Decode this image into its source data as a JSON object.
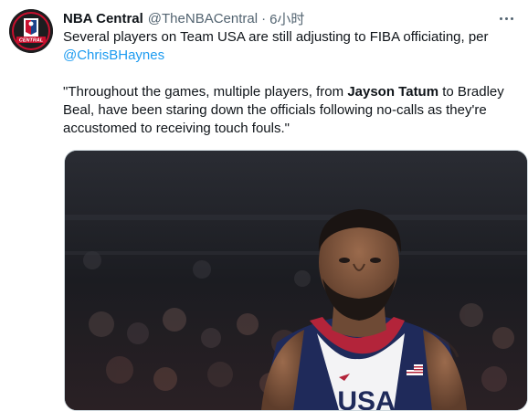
{
  "tweet": {
    "author_name": "NBA Central",
    "author_handle": "@TheNBACentral",
    "separator": "·",
    "time": "6小时",
    "text_line1": "Several players on Team USA are still adjusting to FIBA officiating, per",
    "mention": "@ChrisBHaynes",
    "quote_part1": "\"Throughout the games, multiple players, from ",
    "quote_bold": "Jayson Tatum",
    "quote_part2": " to Bradley Beal, have been staring down the officials following no-calls as they're accustomed to receiving touch fouls.\"",
    "avatar_logo_text": "CENTRAL",
    "jersey_text": "USA"
  },
  "colors": {
    "text": "#0f1419",
    "muted": "#536471",
    "link": "#1d9bf0",
    "jersey_navy": "#1f2a5a",
    "jersey_red": "#b3243a"
  }
}
